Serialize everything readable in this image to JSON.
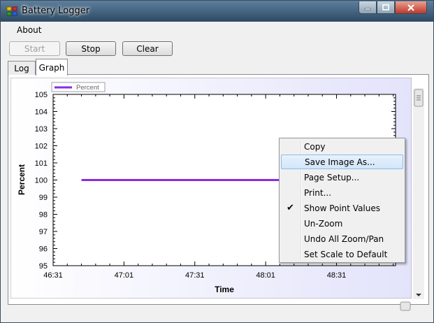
{
  "window": {
    "title": "Battery Logger"
  },
  "menu": {
    "about": "About"
  },
  "toolbar": {
    "start": "Start",
    "stop": "Stop",
    "clear": "Clear"
  },
  "tabs": {
    "log": "Log",
    "graph": "Graph"
  },
  "graph_ui": {
    "context_menu": [
      {
        "label": "Copy",
        "highlighted": false,
        "checked": false
      },
      {
        "label": "Save Image As...",
        "highlighted": true,
        "checked": false
      },
      {
        "label": "Page Setup...",
        "highlighted": false,
        "checked": false
      },
      {
        "label": "Print...",
        "highlighted": false,
        "checked": false
      },
      {
        "label": "Show Point Values",
        "highlighted": false,
        "checked": true
      },
      {
        "label": "Un-Zoom",
        "highlighted": false,
        "checked": false
      },
      {
        "label": "Undo All Zoom/Pan",
        "highlighted": false,
        "checked": false
      },
      {
        "label": "Set Scale to Default",
        "highlighted": false,
        "checked": false
      }
    ]
  },
  "chart_data": {
    "type": "line",
    "xlabel": "Time",
    "ylabel": "Percent",
    "x_ticks": [
      "46:31",
      "47:01",
      "47:31",
      "48:01",
      "48:31"
    ],
    "y_ticks": [
      95,
      96,
      97,
      98,
      99,
      100,
      101,
      102,
      103,
      104,
      105
    ],
    "ylim": [
      95,
      105
    ],
    "xlim_seconds_labels": [
      "46:31",
      "48:56"
    ],
    "legend_position": "top-left",
    "series": [
      {
        "name": "Percent",
        "color": "#8a2be2",
        "x": [
          "46:43",
          "48:31"
        ],
        "y": [
          100,
          100
        ]
      }
    ]
  }
}
